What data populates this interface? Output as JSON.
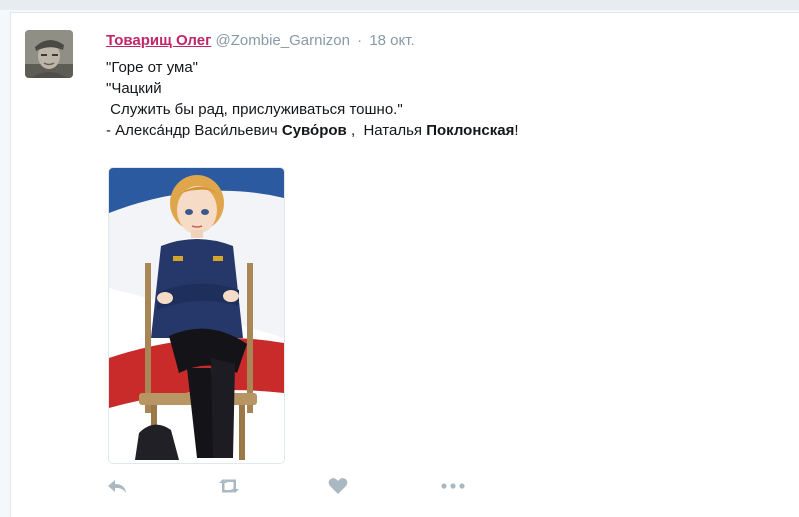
{
  "tweet": {
    "author_name": "Товарищ Олег",
    "author_handle": "@Zombie_Garnizon",
    "separator": "·",
    "date": "18 окт.",
    "lines": [
      "\"Горе от ума\"",
      "\"Чацкий",
      " Служить бы рад, прислуживаться тошно.\""
    ],
    "last_line": {
      "prefix": "- Алекса́ндр Васи́льевич ",
      "bold1": "Суво́ров",
      "middle": " ,  Наталья ",
      "bold2": "Поклонская",
      "suffix": "!"
    }
  },
  "actions": [
    {
      "name": "reply",
      "icon": "reply-icon"
    },
    {
      "name": "retweet",
      "icon": "retweet-icon"
    },
    {
      "name": "like",
      "icon": "heart-icon"
    },
    {
      "name": "more",
      "icon": "more-icon"
    }
  ],
  "colors": {
    "author_name": "#c0256a",
    "muted": "#8899a6",
    "action_icon": "#aab8c2"
  }
}
